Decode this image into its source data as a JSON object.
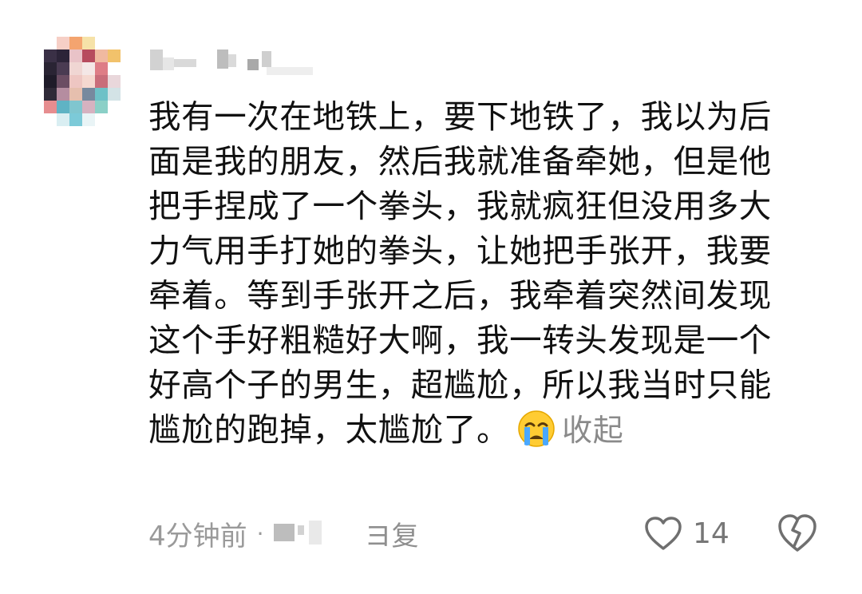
{
  "comment": {
    "author": {
      "name_obscured": "",
      "avatar_icon": "pixelated-avatar"
    },
    "lines": [
      "我有一次在地铁上，要下地铁了，我以为后",
      "面是我的朋友，然后我就准备牵她，但是他",
      "把手捏成了一个拳头，我就疯狂但没用多大",
      "力气用手打她的拳头，让她把手张开，我要",
      "牵着。等到手张开之后，我牵着突然间发现",
      "这个手好粗糙好大啊，我一转头发现是一个",
      "好高个子的男生，超尴尬，所以我当时只能",
      "尴尬的跑掉，太尴尬了。"
    ],
    "emoji": "crying-face-emoji",
    "collapse_label": "收起",
    "time_ago": "4分钟前",
    "separator": "·",
    "reply_label": "回复",
    "reply_label_visible": "ヨ复",
    "like_count": "14",
    "colors": {
      "text": "#111111",
      "meta": "#9a9a9a",
      "icon": "#6f6f6f"
    }
  }
}
